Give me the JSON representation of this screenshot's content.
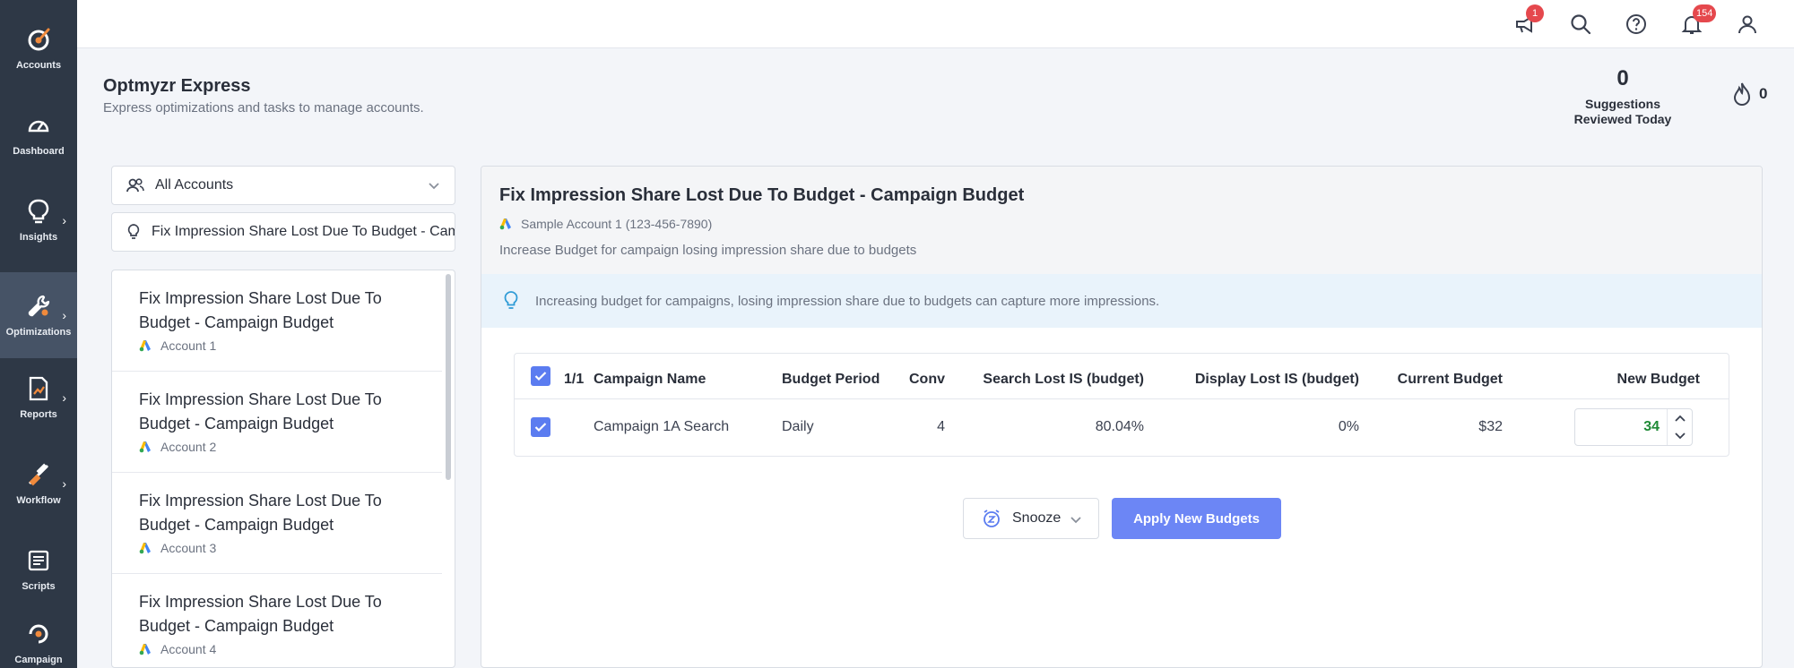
{
  "sidebar": {
    "items": [
      {
        "label": "Accounts",
        "icon": "accounts-icon"
      },
      {
        "label": "Dashboard",
        "icon": "gauge-icon"
      },
      {
        "label": "Insights",
        "icon": "lightbulb-icon"
      },
      {
        "label": "Optimizations",
        "icon": "wrench-icon"
      },
      {
        "label": "Reports",
        "icon": "report-icon"
      },
      {
        "label": "Workflow",
        "icon": "workflow-icon"
      },
      {
        "label": "Scripts",
        "icon": "script-icon"
      },
      {
        "label": "Campaign",
        "icon": "campaign-icon"
      }
    ]
  },
  "topbar": {
    "announcements_badge": "1",
    "notifications_badge": "154"
  },
  "header": {
    "title": "Optmyzr Express",
    "subtitle": "Express optimizations and tasks to manage accounts.",
    "suggestions_count": "0",
    "suggestions_label_1": "Suggestions",
    "suggestions_label_2": "Reviewed Today",
    "streak_count": "0"
  },
  "filters": {
    "accounts_select": "All Accounts",
    "optimization_filter": "Fix Impression Share Lost Due To Budget - Campaign Budget"
  },
  "list": {
    "items": [
      {
        "title_1": "Fix Impression Share Lost Due To",
        "title_2": "Budget - Campaign Budget",
        "account": "Account 1"
      },
      {
        "title_1": "Fix Impression Share Lost Due To",
        "title_2": "Budget - Campaign Budget",
        "account": "Account 2"
      },
      {
        "title_1": "Fix Impression Share Lost Due To",
        "title_2": "Budget - Campaign Budget",
        "account": "Account 3"
      },
      {
        "title_1": "Fix Impression Share Lost Due To",
        "title_2": "Budget - Campaign Budget",
        "account": "Account 4"
      }
    ]
  },
  "panel": {
    "title": "Fix Impression Share Lost Due To Budget - Campaign Budget",
    "account": "Sample Account 1 (123-456-7890)",
    "description": "Increase Budget for campaign losing impression share due to budgets",
    "tip": "Increasing budget for campaigns, losing impression share due to budgets can capture more impressions."
  },
  "table": {
    "selection": "1/1",
    "headers": {
      "campaign_name": "Campaign Name",
      "budget_period": "Budget Period",
      "conv": "Conv",
      "search_lost": "Search Lost IS (budget)",
      "display_lost": "Display Lost IS (budget)",
      "current_budget": "Current Budget",
      "new_budget": "New Budget"
    },
    "rows": [
      {
        "campaign_name": "Campaign 1A Search",
        "budget_period": "Daily",
        "conv": "4",
        "search_lost": "80.04%",
        "display_lost": "0%",
        "current_budget": "$32",
        "new_budget": "34"
      }
    ]
  },
  "actions": {
    "snooze": "Snooze",
    "apply": "Apply New Budgets"
  },
  "colors": {
    "sidebar_bg": "#2e3846",
    "accent": "#6c86f5",
    "checkbox": "#5b7cf0",
    "badge": "#e5484d",
    "new_budget_value": "#1f8a36"
  }
}
